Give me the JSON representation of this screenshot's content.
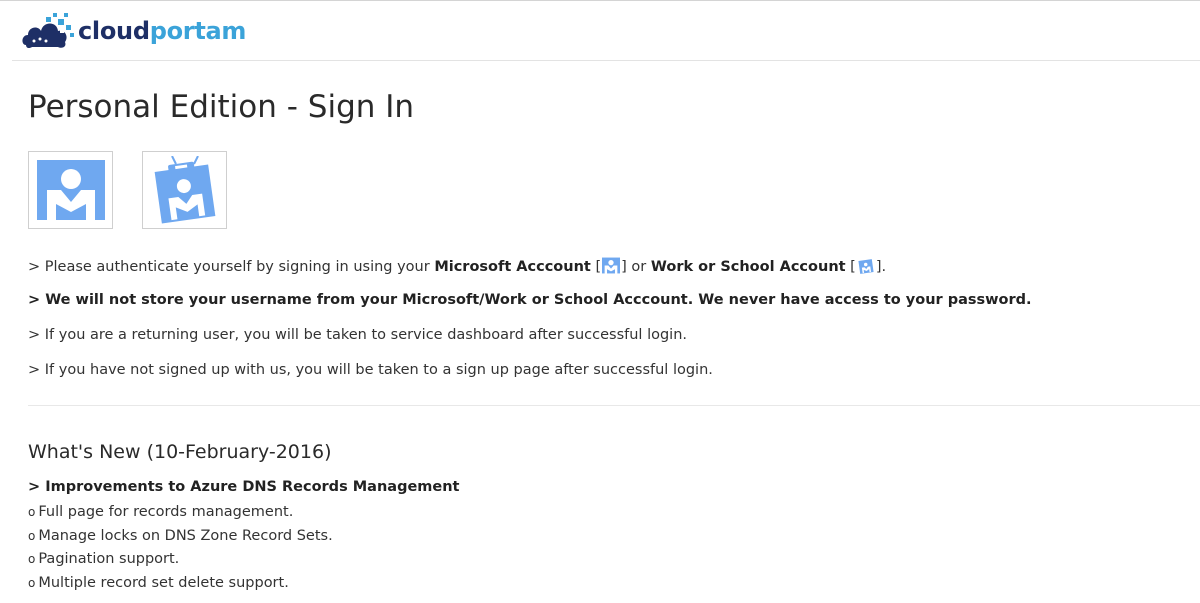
{
  "brand": {
    "name_part1": "cloud",
    "name_part2": "portam"
  },
  "page_title": "Personal Edition - Sign In",
  "sign_in_options": [
    {
      "name": "Microsoft Account",
      "icon": "microsoft-account-icon"
    },
    {
      "name": "Work or School Account",
      "icon": "work-school-account-icon"
    }
  ],
  "info": {
    "line1": {
      "prefix": "> Please authenticate yourself by signing in using your ",
      "ms_account": "Microsoft Acccount",
      "bracket_open": " [",
      "bracket_close": "]",
      "or": " or ",
      "work_account": "Work or School Account",
      "end": "]."
    },
    "line2": "> We will not store your username from your Microsoft/Work or School Acccount. We never have access to your password.",
    "line3": "> If you are a returning user, you will be taken to service dashboard after successful login.",
    "line4": "> If you have not signed up with us, you will be taken to a sign up page after successful login."
  },
  "whats_new": {
    "title": "What's New (10-February-2016)",
    "headline": "> Improvements to Azure DNS Records Management",
    "bullet": "o",
    "items": [
      "Full page for records management.",
      "Manage locks on DNS Zone Record Sets.",
      "Pagination support.",
      "Multiple record set delete support."
    ]
  },
  "colors": {
    "brand_dark": "#1e2f66",
    "brand_light": "#3ba3d9",
    "icon_blue": "#6fa8f0"
  }
}
